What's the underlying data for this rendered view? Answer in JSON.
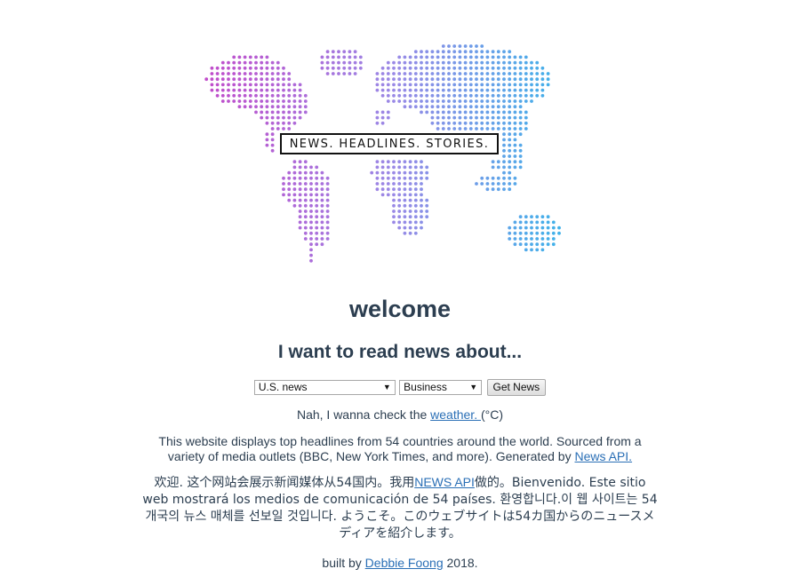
{
  "hero": {
    "tagline": "NEWS. HEADLINES. STORIES.",
    "map_colors": [
      "#c349c9",
      "#9a89e6",
      "#2fb9ea"
    ]
  },
  "heading": {
    "title": "welcome",
    "subtitle": "I want to read news about..."
  },
  "controls": {
    "country_selected": "U.S. news",
    "category_selected": "Business",
    "submit_label": "Get News"
  },
  "weather": {
    "prefix": "Nah, I wanna check the ",
    "link": "weather. ",
    "suffix": "(°C)"
  },
  "about": {
    "text": "This website displays top headlines from 54 countries around the world. Sourced from a variety of media outlets (BBC, New York Times, and more). Generated by ",
    "link": "News API."
  },
  "multilingual": {
    "part1": "欢迎. 这个网站会展示新闻媒体从54国内。我用",
    "link": "NEWS API",
    "part2": "做的。Bienvenido. Este sitio web mostrará los medios de comunicación de 54 países. 환영합니다.이 웹 사이트는 54 개국의 뉴스 매체를 선보일 것입니다. ようこそ。このウェブサイトは54カ国からのニュースメディアを紹介します。"
  },
  "credit": {
    "prefix": "built by ",
    "author": "Debbie Foong",
    "suffix": " 2018."
  }
}
